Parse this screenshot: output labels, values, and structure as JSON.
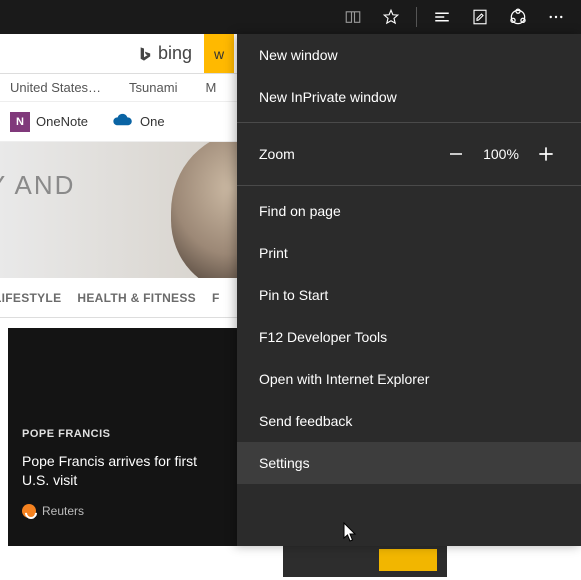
{
  "titlebar": {
    "reading_icon": "reading-view",
    "star_icon": "favorite",
    "hub_icon": "hub",
    "note_icon": "web-note",
    "share_icon": "share",
    "more_icon": "more"
  },
  "search": {
    "engine": "bing",
    "button_partial": "w"
  },
  "news_tabs": [
    "United States…",
    "Tsunami",
    "M"
  ],
  "apps": {
    "onenote": {
      "label": "OneNote",
      "color": "#80397b"
    },
    "onedrive": {
      "label_partial": "One",
      "color": "#0a64a4"
    }
  },
  "hero": {
    "text_partial": "TY AND"
  },
  "categories": [
    "LIFESTYLE",
    "HEALTH & FITNESS",
    "F"
  ],
  "story": {
    "tag": "POPE FRANCIS",
    "headline": "Pope Francis arrives for first U.S. visit",
    "source": "Reuters"
  },
  "menu": {
    "new_window": "New window",
    "new_inprivate": "New InPrivate window",
    "zoom_label": "Zoom",
    "zoom_value": "100%",
    "find": "Find on page",
    "print": "Print",
    "pin": "Pin to Start",
    "f12": "F12 Developer Tools",
    "open_ie": "Open with Internet Explorer",
    "feedback": "Send feedback",
    "settings": "Settings"
  }
}
